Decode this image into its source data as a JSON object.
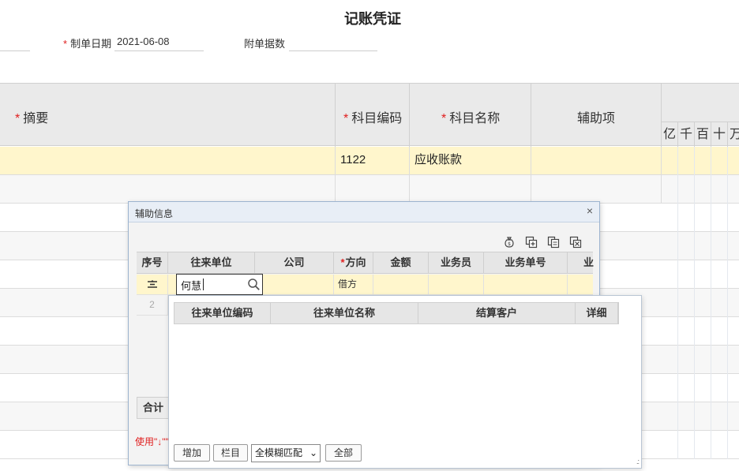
{
  "title": "记账凭证",
  "header": {
    "date_label": "制单日期",
    "date_value": "2021-06-08",
    "attachments_label": "附单据数",
    "attachments_value": ""
  },
  "voucher_table": {
    "headers": {
      "summary": "摘要",
      "account_code": "科目编码",
      "account_name": "科目名称",
      "auxiliary": "辅助项"
    },
    "digit_headers": [
      "亿",
      "千",
      "百",
      "十",
      "万"
    ],
    "rows": [
      {
        "summary": "",
        "account_code": "1122",
        "account_name": "应收账款",
        "auxiliary": ""
      }
    ]
  },
  "dialog": {
    "title": "辅助信息",
    "close_label": "×",
    "columns": [
      "序号",
      "往来单位",
      "公司",
      "方向",
      "金额",
      "业务员",
      "业务单号",
      "业"
    ],
    "rows": [
      {
        "index": "",
        "partner": "何慧",
        "company": "",
        "direction": "借方"
      },
      {
        "index": "2",
        "partner": "",
        "company": "",
        "direction": ""
      }
    ],
    "total_label": "合计",
    "hint": "使用\"↓\"\""
  },
  "dropdown": {
    "columns": [
      "往来单位编码",
      "往来单位名称",
      "结算客户",
      "详细"
    ],
    "add_button": "增加",
    "columns_button": "栏目",
    "match_select": "全模糊匹配",
    "all_button": "全部"
  },
  "colors": {
    "required": "#e02020",
    "selected_row": "#fff6cc",
    "header_bg": "#eaeaea",
    "dialog_border": "#9db4cf"
  }
}
